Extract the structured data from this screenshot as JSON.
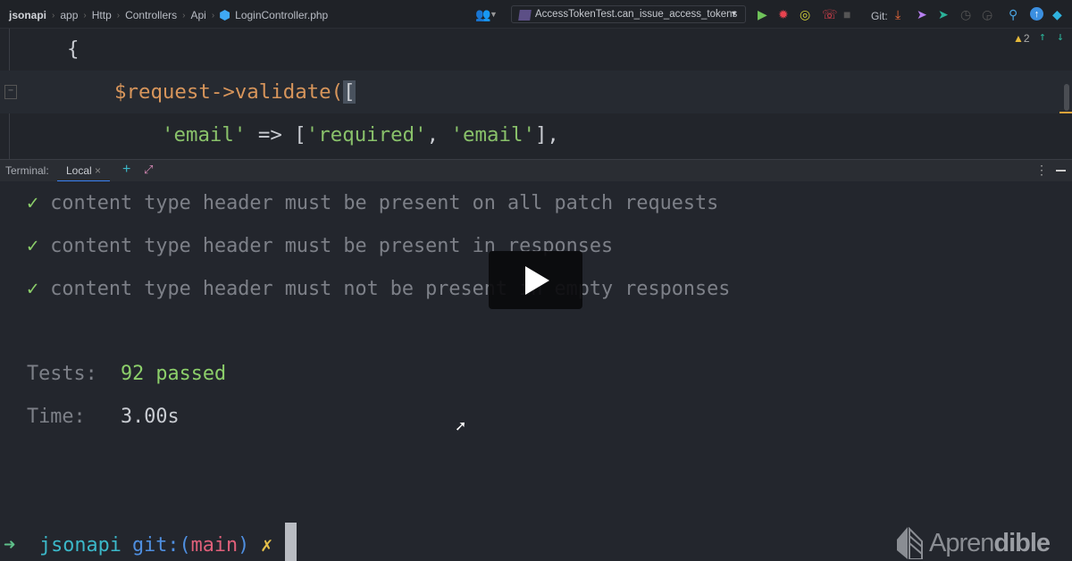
{
  "breadcrumb": [
    "jsonapi",
    "app",
    "Http",
    "Controllers",
    "Api",
    "LoginController.php"
  ],
  "run_config": "AccessTokenTest.can_issue_access_tokens",
  "git_label": "Git:",
  "warnings": "2",
  "code": {
    "line1": "{",
    "line2_var": "$request",
    "line2_rest": "->validate(",
    "line2_bracket": "[",
    "line3_a": "'email'",
    "line3_b": " => [",
    "line3_c": "'required'",
    "line3_d": ", ",
    "line3_e": "'email'",
    "line3_f": "],"
  },
  "terminal": {
    "label": "Terminal:",
    "tab": "Local",
    "close": "×",
    "add": "+"
  },
  "output": {
    "checks": [
      "content type header must be present on all patch requests",
      "content type header must be present in responses",
      "content type header must not be present in empty responses"
    ],
    "check_mark": "✓",
    "tests_label": "Tests:",
    "tests_value": "92 passed",
    "time_label": "Time:",
    "time_value": "3.00s"
  },
  "prompt": {
    "arrow": "➜",
    "dir": "jsonapi",
    "git": "git:(",
    "branch": "main",
    "git_close": ")",
    "dirty": "✗"
  },
  "logo": {
    "light": "Apren",
    "bold": "dible"
  }
}
